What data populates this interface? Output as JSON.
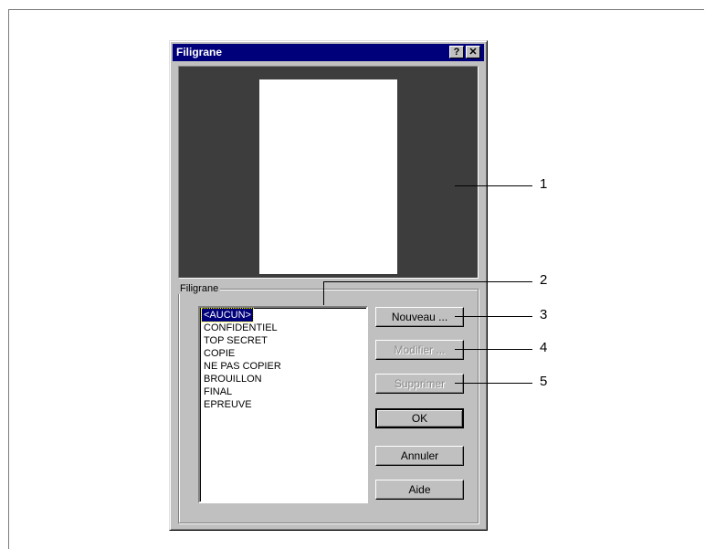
{
  "dialog": {
    "title": "Filigrane",
    "help_glyph": "?",
    "close_glyph": "✕",
    "group_label": "Filigrane",
    "list_items": [
      "<AUCUN>",
      "CONFIDENTIEL",
      "TOP SECRET",
      "COPIE",
      "NE PAS COPIER",
      "BROUILLON",
      "FINAL",
      "EPREUVE"
    ],
    "selected_index": 0,
    "buttons": {
      "new": "Nouveau ...",
      "modify": "Modifier ...",
      "delete": "Supprimer",
      "ok": "OK",
      "cancel": "Annuler",
      "help": "Aide"
    }
  },
  "callouts": [
    "1",
    "2",
    "3",
    "4",
    "5"
  ]
}
